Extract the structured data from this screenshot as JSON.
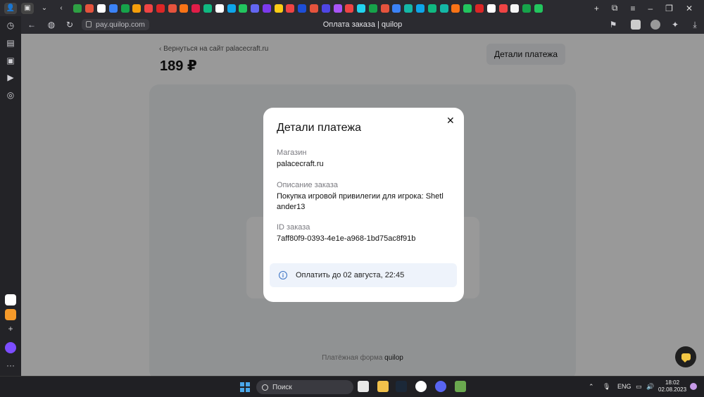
{
  "browser": {
    "url": "pay.quilop.com",
    "tab_title": "Оплата заказа | quilop"
  },
  "taskbar": {
    "search_placeholder": "Поиск",
    "language": "ENG",
    "time": "18:02",
    "date": "02.08.2023"
  },
  "page": {
    "back_link": "Вернуться на сайт palacecraft.ru",
    "amount": "189 ₽",
    "details_button": "Детали платежа",
    "footer_text": "Платёжная форма",
    "footer_brand": "quilop"
  },
  "modal": {
    "title": "Детали платежа",
    "shop_label": "Магазин",
    "shop_value": "palacecraft.ru",
    "description_label": "Описание заказа",
    "description_line1": "Покупка игровой привилегии для игрока: Shetl",
    "description_line2": "ander13",
    "order_id_label": "ID заказа",
    "order_id_value": "7aff80f9-0393-4e1e-a968-1bd75ac8f91b",
    "deadline_note": "Оплатить до 02 августа, 22:45"
  },
  "icons": {
    "close": "close-icon",
    "info": "info-icon",
    "chat": "chat-icon",
    "lock": "lock-icon"
  },
  "colors": {
    "accent_info": "#3b73c4",
    "chat_badge": "#f3c744"
  }
}
